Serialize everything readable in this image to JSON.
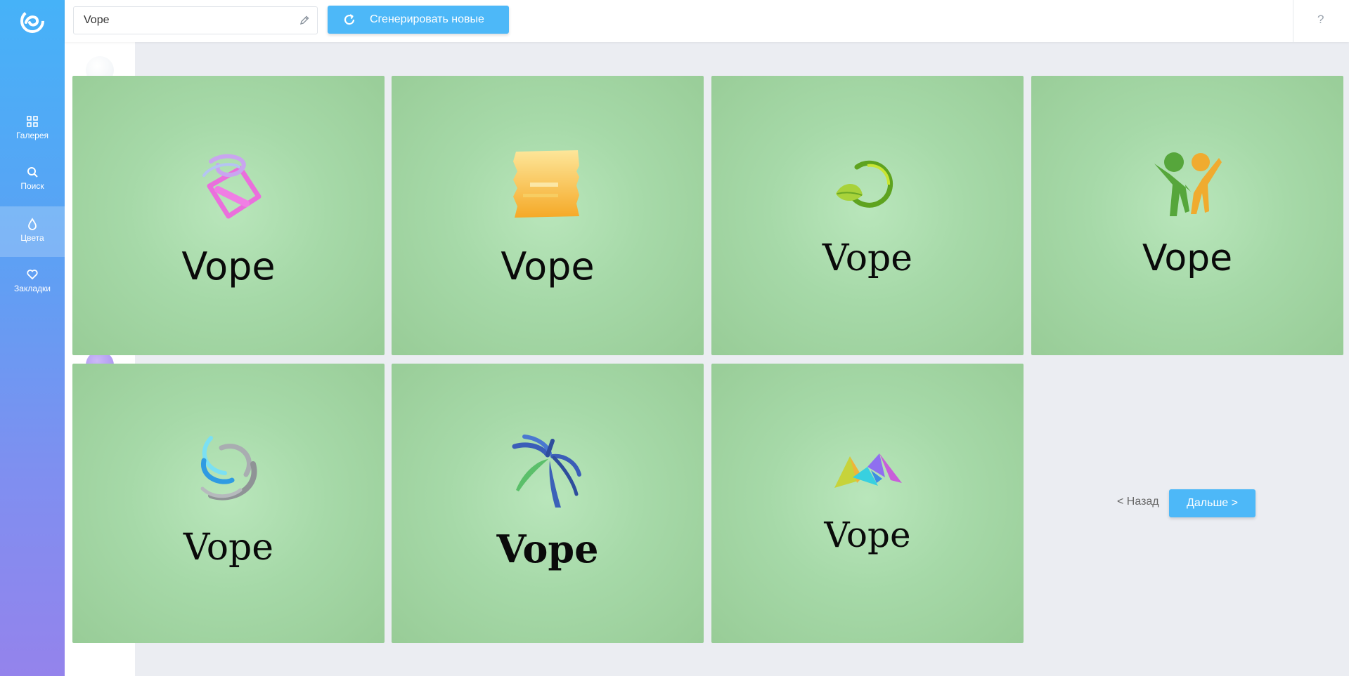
{
  "app": {
    "logo_icon": "swirl-logo-icon"
  },
  "nav": {
    "items": [
      {
        "label": "Галерея",
        "icon": "grid-icon"
      },
      {
        "label": "Поиск",
        "icon": "search-icon"
      },
      {
        "label": "Цвета",
        "icon": "drop-icon",
        "active": true
      },
      {
        "label": "Закладки",
        "icon": "heart-icon"
      }
    ]
  },
  "toolbar": {
    "name_value": "Vope",
    "generate_label": "Сгенерировать новые",
    "help_label": "?"
  },
  "colors": {
    "swatches": [
      "#f4f6f8",
      "#3f444f",
      "#e8bf9c",
      "#9dd19e",
      "#f0f6fc",
      "#8dd9dc",
      "#cce4f5",
      "#b39cf2"
    ],
    "accent": "#4db8f8"
  },
  "logos": [
    {
      "brand": "Vope",
      "icon": "pink-ribbon-box-icon",
      "font": "sans"
    },
    {
      "brand": "Vope",
      "icon": "yellow-brush-square-icon",
      "font": "sans"
    },
    {
      "brand": "Vope",
      "icon": "green-leaf-circle-icon",
      "font": "serif"
    },
    {
      "brand": "Vope",
      "icon": "two-people-icon",
      "font": "sans"
    },
    {
      "brand": "Vope",
      "icon": "blue-grey-swirl-icon",
      "font": "serif"
    },
    {
      "brand": "Vope",
      "icon": "palm-tree-icon",
      "font": "serif-bold"
    },
    {
      "brand": "Vope",
      "icon": "colorful-mountains-icon",
      "font": "serif"
    }
  ],
  "pagination": {
    "back_label": "< Назад",
    "next_label": "Дальше >"
  }
}
